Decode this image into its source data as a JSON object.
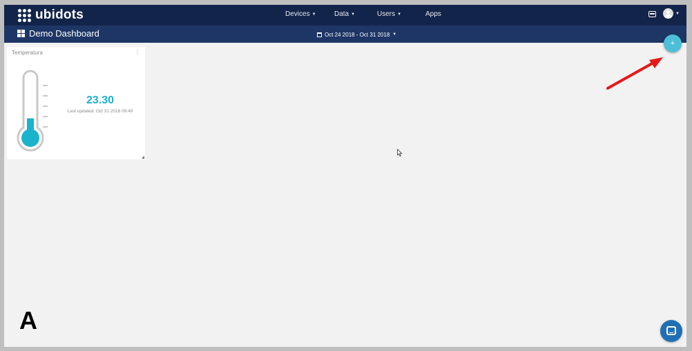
{
  "app": {
    "logo_text": "ubidots"
  },
  "nav": {
    "items": [
      {
        "label": "Devices",
        "has_caret": true
      },
      {
        "label": "Data",
        "has_caret": true
      },
      {
        "label": "Users",
        "has_caret": true
      },
      {
        "label": "Apps",
        "has_caret": false
      }
    ],
    "right_icons": [
      "inbox-icon",
      "user-avatar-icon"
    ]
  },
  "dashboard": {
    "title": "Demo Dashboard",
    "date_range": "Oct 24 2018 - Oct 31 2018",
    "add_button_label": "+"
  },
  "widget": {
    "title": "Temperatura",
    "value": "23.30",
    "last_updated": "Last updated: Oct 31 2018 09:49",
    "thermometer_fill_fraction": 0.35
  },
  "annotation": {
    "letter": "A",
    "arrow_color": "#e81818"
  },
  "colors": {
    "navbar": "#13244a",
    "subbar": "#1d3665",
    "accent": "#1ab3cc",
    "add_button": "#4cbfd6",
    "chat_button": "#1f6fb5"
  }
}
